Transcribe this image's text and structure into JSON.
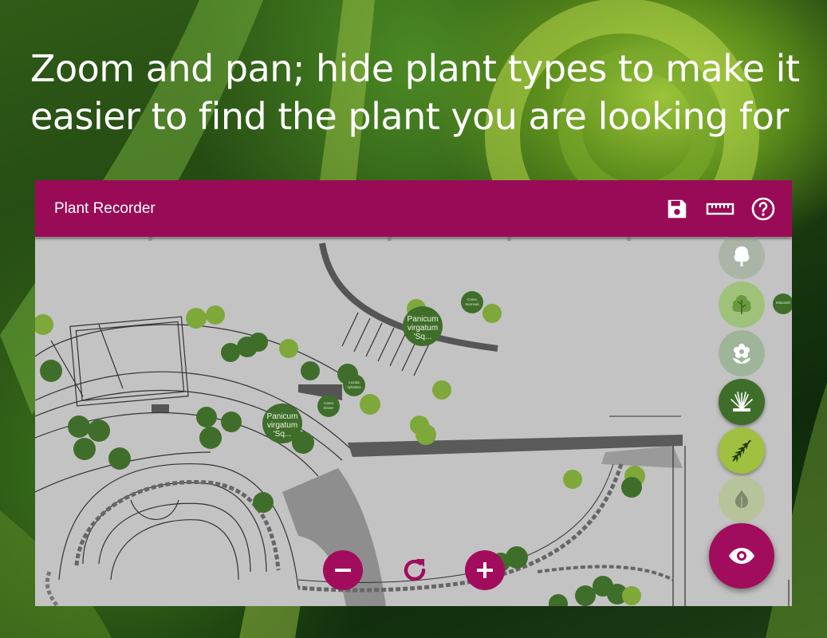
{
  "headline": {
    "line1": "Zoom and pan; hide plant types to make it",
    "line2": "easier to find the plant you are looking for"
  },
  "app": {
    "title": "Plant Recorder",
    "toolbar": [
      "save-icon",
      "ruler-icon",
      "help-icon"
    ]
  },
  "colors": {
    "brand": "#9a0b57",
    "map_background": "#c3c3c3",
    "plant_dark": "#3f6e2a",
    "plant_light": "#7ea83a"
  },
  "plant_labels": [
    {
      "name": "panicum-1",
      "lines": [
        "Panicum",
        "virgatum",
        "'Sq..."
      ]
    },
    {
      "name": "panicum-2",
      "lines": [
        "Panicum",
        "virgatum",
        "'Sq..."
      ]
    }
  ],
  "filters": [
    {
      "name": "tree-filter",
      "icon": "tree-icon",
      "active": false
    },
    {
      "name": "shrub-filter",
      "icon": "shrub-icon",
      "active": false
    },
    {
      "name": "flower-filter",
      "icon": "flower-icon",
      "active": false
    },
    {
      "name": "grass-filter",
      "icon": "grass-icon",
      "active": true
    },
    {
      "name": "fern-filter",
      "icon": "fern-icon",
      "active": true
    },
    {
      "name": "bulb-filter",
      "icon": "bulb-icon",
      "active": false
    }
  ],
  "controls": [
    "zoom-out-icon",
    "reset-view-icon",
    "zoom-in-icon",
    "visibility-icon"
  ]
}
